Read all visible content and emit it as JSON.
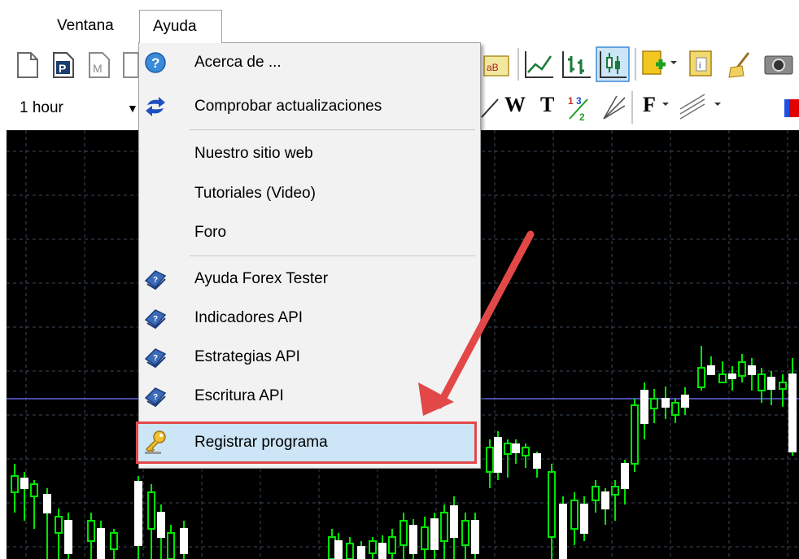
{
  "menubar": {
    "items": [
      {
        "label": "Ventana"
      },
      {
        "label": "Ayuda"
      }
    ]
  },
  "toolbar": {
    "timeframe_value": "1 hour",
    "text_tools": {
      "w": "W",
      "t": "T",
      "f": "F"
    }
  },
  "help_menu": {
    "items": [
      {
        "label": "Acerca de ...",
        "icon": "help-circle-icon"
      },
      {
        "label": "Comprobar actualizaciones",
        "icon": "refresh-arrows-icon"
      },
      {
        "label": "Nuestro sitio web"
      },
      {
        "label": "Tutoriales (Video)"
      },
      {
        "label": "Foro"
      },
      {
        "label": "Ayuda Forex Tester",
        "icon": "help-book-icon"
      },
      {
        "label": "Indicadores API",
        "icon": "help-book-icon"
      },
      {
        "label": "Estrategias API",
        "icon": "help-book-icon"
      },
      {
        "label": "Escritura API",
        "icon": "help-book-icon"
      },
      {
        "label": "Registrar programa",
        "icon": "key-icon"
      }
    ],
    "highlighted_item": "Registrar programa"
  },
  "colors": {
    "chart_background": "#000000",
    "grid": "#3c4a5a",
    "candle": "#00e600",
    "price_line": "#4a4aa8",
    "annotation": "#e34848",
    "highlight": "#cce5f7"
  }
}
